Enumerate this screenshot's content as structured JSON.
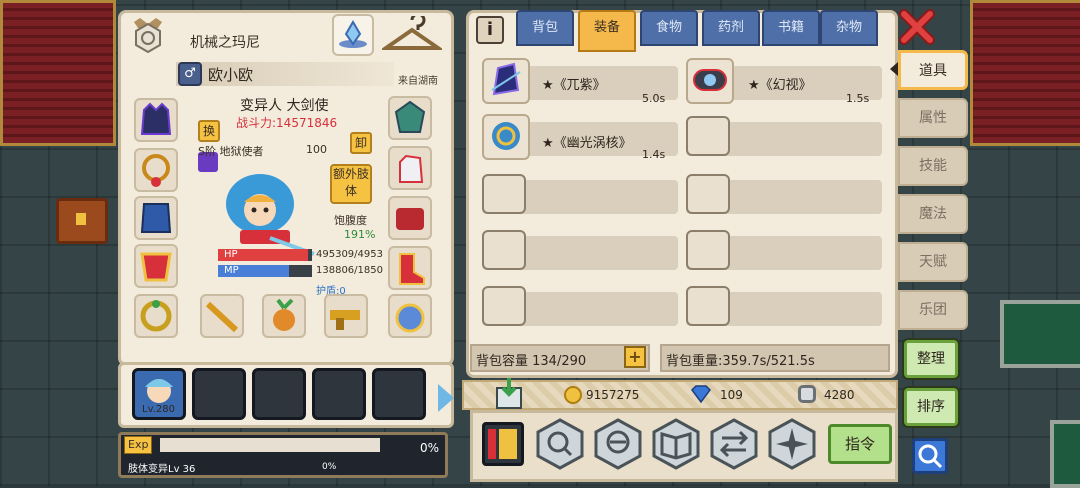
{
  "character": {
    "class_name": "机械之玛尼",
    "gender_symbol": "♂",
    "player_name": "欧小欧",
    "origin": "来自湖南",
    "race_class": "变异人 大剑使",
    "combat_power": "战斗力:14571846",
    "swap_label": "换",
    "unequip_label": "卸",
    "realm": "S阶 地狱使者",
    "realm_num": "100",
    "extra_limb_label": "额外肢体",
    "satiety_label": "饱腹度",
    "satiety_value": "191%",
    "hp_label": "HP",
    "hp_text": "495309/4953",
    "hp_fraction": 0.96,
    "mp_label": "MP",
    "mp_text": "138806/1850",
    "mp_fraction": 0.75,
    "shield": "护盾:0"
  },
  "companions": {
    "level": "Lv.280"
  },
  "exp": {
    "badge": "Exp",
    "percent": "0%",
    "limb_label": "肢体变异Lv 36",
    "limb_percent": "0%"
  },
  "inventory": {
    "tabs": [
      "背包",
      "装备",
      "食物",
      "药剂",
      "书籍",
      "杂物"
    ],
    "active_tab": 1,
    "items": [
      {
        "name": "★《兀紫》",
        "time": "5.0s",
        "icon": "purple-armor-icon"
      },
      {
        "name": "★《幻视》",
        "time": "1.5s",
        "icon": "goggles-icon"
      },
      {
        "name": "★《幽光涡核》",
        "time": "1.4s",
        "icon": "vortex-core-icon"
      }
    ],
    "capacity": "背包容量 134/290",
    "weight": "背包重量:359.7s/521.5s"
  },
  "currency": {
    "gold": "9157275",
    "diamond": "109",
    "silver": "4280"
  },
  "actions": {
    "command_label": "指令"
  },
  "side_tabs": [
    "道具",
    "属性",
    "技能",
    "魔法",
    "天赋",
    "乐团"
  ],
  "side_active": 0,
  "side_buttons": {
    "organize": "整理",
    "sort": "排序"
  },
  "colors": {
    "accent": "#f5b84a",
    "tab_blue": "#4f6fa8",
    "hp": "#e04040",
    "mp": "#4a7fd8",
    "power_red": "#d8303a",
    "green_btn": "#b3e08a"
  }
}
